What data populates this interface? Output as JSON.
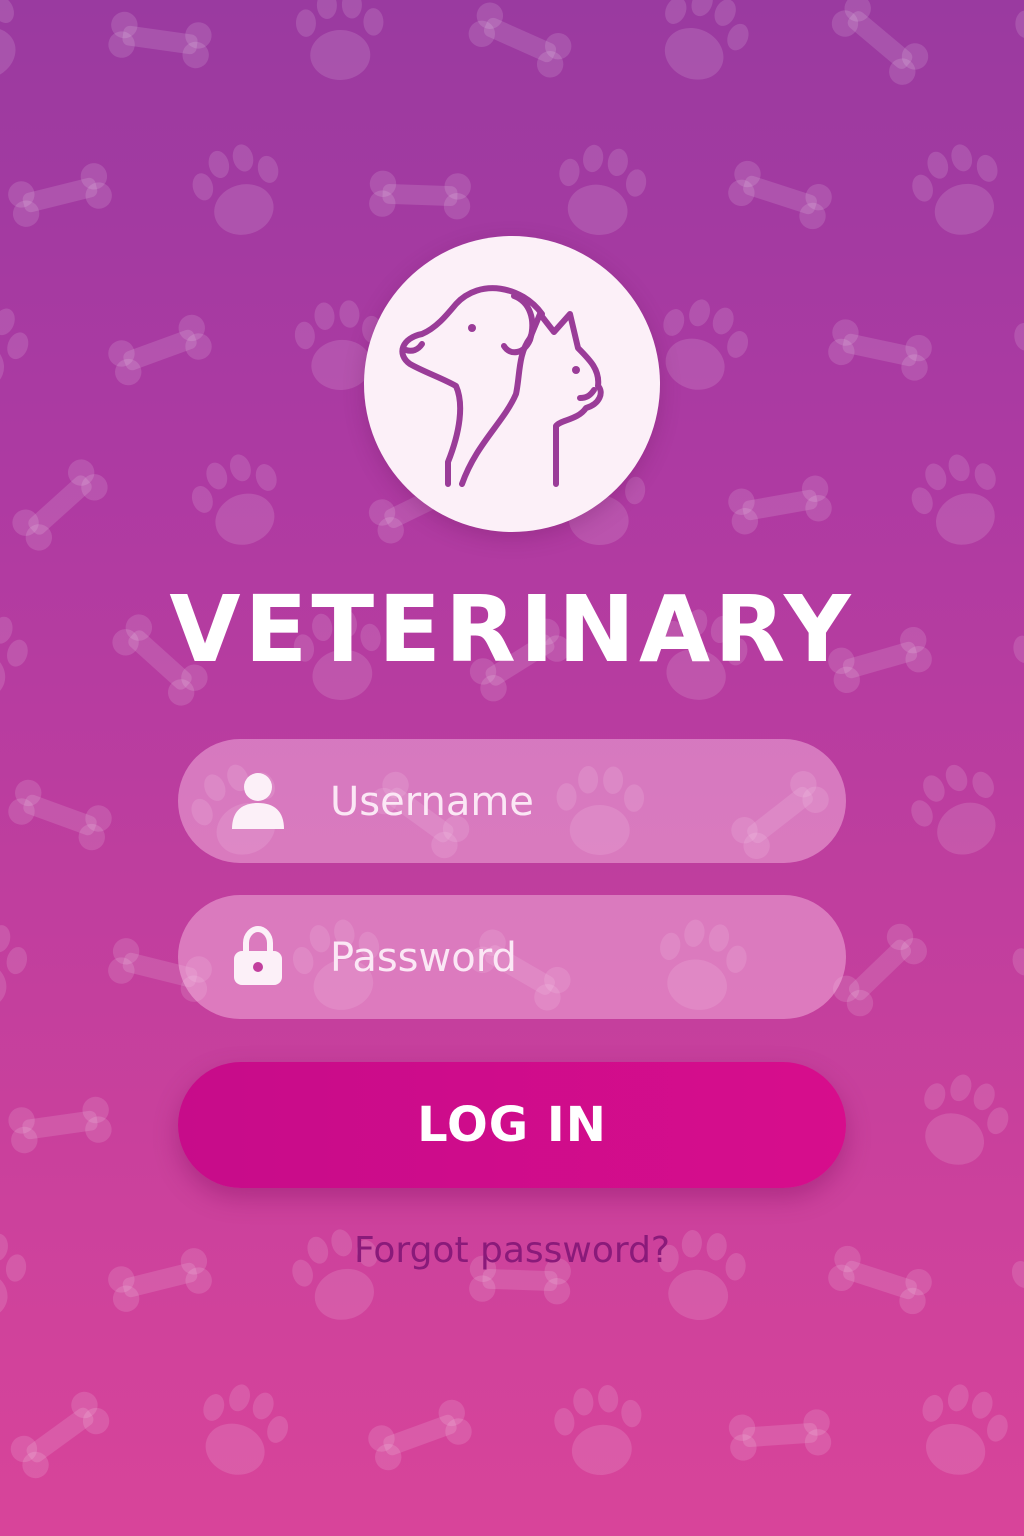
{
  "app": {
    "title": "VETERINARY"
  },
  "logo": {
    "icon": "dog-cat-icon"
  },
  "form": {
    "username": {
      "placeholder": "Username",
      "value": "",
      "icon": "user-icon"
    },
    "password": {
      "placeholder": "Password",
      "value": "",
      "icon": "lock-icon"
    },
    "login_label": "LOG IN",
    "forgot_label": "Forgot password?"
  },
  "colors": {
    "bg_top": "#9a3aa0",
    "bg_bottom": "#d8449a",
    "button": "#d70d8c",
    "logo_bg": "#fcf0f8",
    "icon_stroke": "#9a3c98",
    "forgot_text": "#8a1a7a",
    "pattern": "#ffffff"
  },
  "background": {
    "pattern_icons": [
      "paw-icon",
      "bone-icon"
    ]
  }
}
